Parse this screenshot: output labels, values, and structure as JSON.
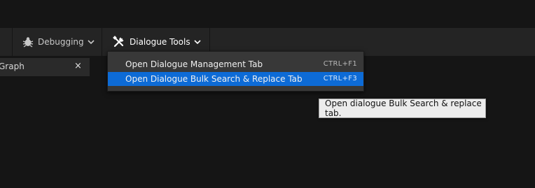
{
  "toolbar": {
    "debugging_label": "Debugging",
    "dialogue_tools_label": "Dialogue Tools"
  },
  "tabs": {
    "graph_label": "Graph",
    "close_glyph": "×"
  },
  "dialogue_menu": {
    "items": [
      {
        "label": "Open Dialogue Management Tab",
        "shortcut": "CTRL+F1"
      },
      {
        "label": "Open Dialogue Bulk Search & Replace Tab",
        "shortcut": "CTRL+F3"
      }
    ],
    "hovered_index": 1
  },
  "tooltip": {
    "text": "Open dialogue Bulk Search & replace tab."
  },
  "colors": {
    "background": "#151515",
    "toolbar": "#242424",
    "menu": "#383838",
    "highlight": "#0d6bd6",
    "tooltip_bg": "#ececec"
  },
  "icons": {
    "debugging": "bug-icon",
    "dialogue_tools": "tools-icon",
    "dropdown": "chevron-down-icon"
  }
}
